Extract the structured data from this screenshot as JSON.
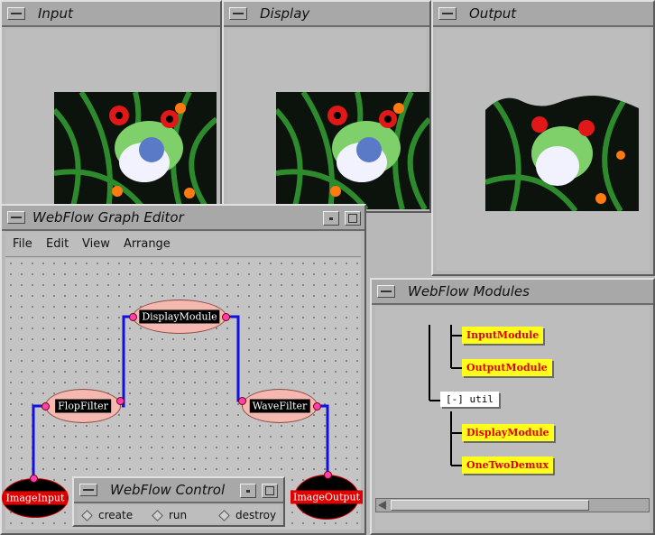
{
  "windows": {
    "input": {
      "title": "Input"
    },
    "display": {
      "title": "Display"
    },
    "output": {
      "title": "Output"
    }
  },
  "graph_editor": {
    "title": "WebFlow Graph Editor",
    "menu": [
      "File",
      "Edit",
      "View",
      "Arrange"
    ],
    "nodes": {
      "display": "DisplayModule",
      "flop": "FlopFilter",
      "wave": "WaveFilter",
      "image_input": "ImageInput",
      "image_output": "ImageOutput"
    }
  },
  "modules": {
    "title": "WebFlow Modules",
    "items": [
      "InputModule",
      "OutputModule"
    ],
    "folder": "[-] util",
    "folder_items": [
      "DisplayModule",
      "OneTwoDemux"
    ]
  },
  "control": {
    "title": "WebFlow Control",
    "options": [
      "create",
      "run",
      "destroy"
    ]
  },
  "colors": {
    "connection": "#1010e0",
    "module_tag": "#ffff1a",
    "module_text": "#e00000",
    "node_fill": "#f4b8b0",
    "port": "#ff3fb0"
  },
  "icons": [
    "window-menu-icon",
    "minimize-icon",
    "maximize-icon",
    "diamond-radio-icon"
  ]
}
